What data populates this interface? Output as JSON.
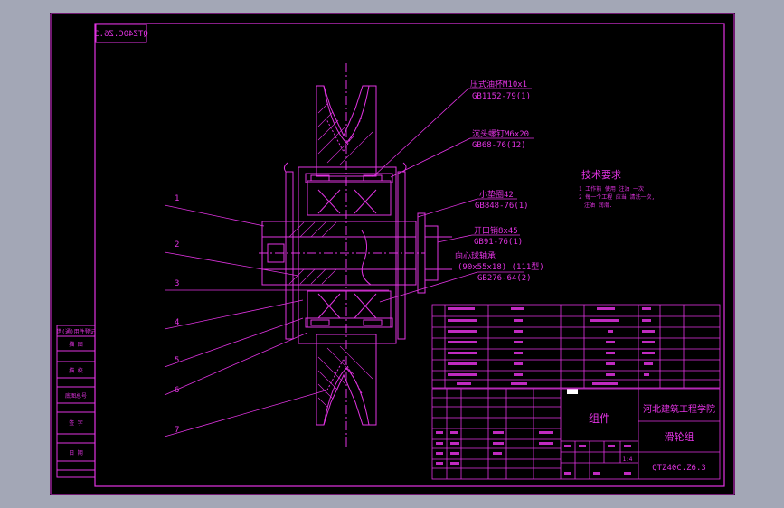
{
  "drawing": {
    "top_code": "QTZ40C.Z6.3",
    "annotations": [
      {
        "line1": "压式油杯M10x1",
        "line2": "GB1152-79(1)"
      },
      {
        "line1": "沉头螺钉M6x20",
        "line2": "GB68-76(12)"
      },
      {
        "line1": "小垫圈42",
        "line2": "GB848-76(1)"
      },
      {
        "line1": "开口销8x45",
        "line2": "GB91-76(1)"
      },
      {
        "line1": "向心球轴承",
        "line2": "(90x55x18) (111型)",
        "line3": "GB276-64(2)"
      }
    ],
    "part_numbers": [
      "1",
      "2",
      "3",
      "4",
      "5",
      "6",
      "7"
    ],
    "tech_req": {
      "title": "技术要求",
      "items": [
        "1 工作前 使用 注油 一次",
        "2 每一个工程 应当 清洗一次,",
        "注油 润滑."
      ]
    },
    "title_block": {
      "assembly": "组件",
      "school": "河北建筑工程学院",
      "drawing_name": "滑轮组",
      "drawing_no": "QTZ40C.Z6.3",
      "scale": "1:4"
    },
    "side_block": [
      "借(通)用件登记",
      "描  图",
      "描  校",
      "底图总号",
      "签  字",
      "日  期"
    ]
  },
  "colors": {
    "background": "#a3a7b6",
    "paper": "#000000",
    "line": "#e233e2",
    "white": "#ffffff"
  }
}
